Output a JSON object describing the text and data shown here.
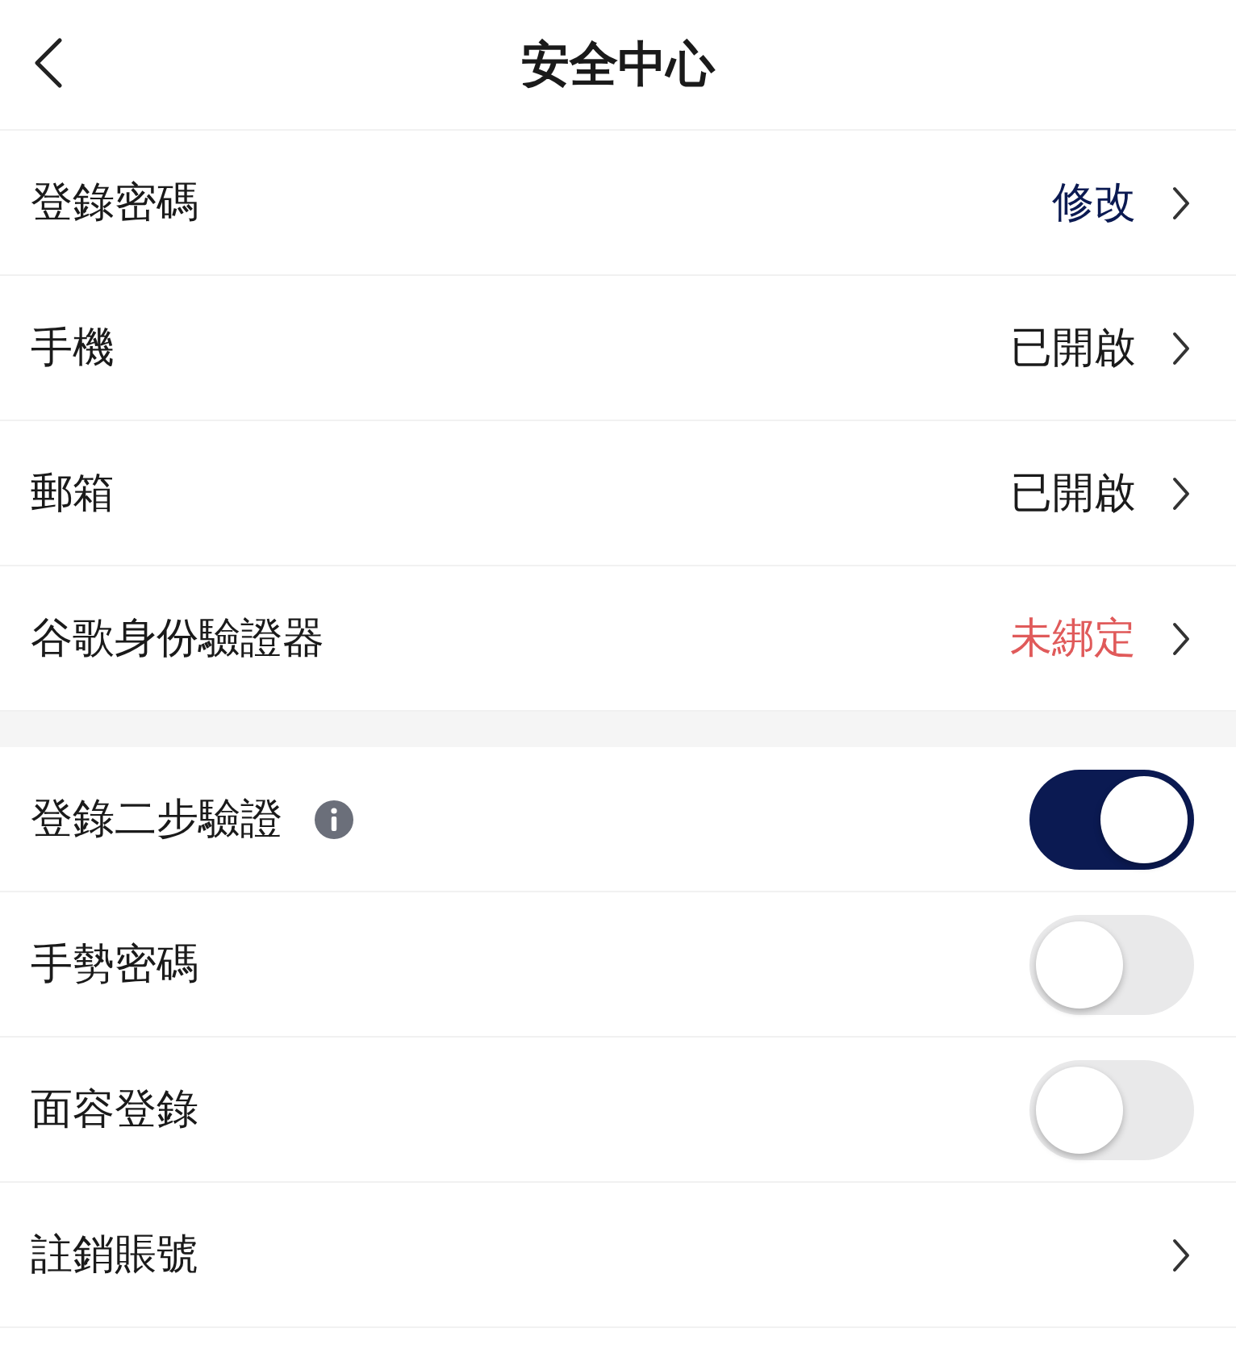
{
  "header": {
    "title": "安全中心"
  },
  "sections": [
    {
      "rows": [
        {
          "kind": "link",
          "label": "登錄密碼",
          "value": "修改",
          "color": "#0b1a52"
        },
        {
          "kind": "link",
          "label": "手機",
          "value": "已開啟",
          "color": "#1a1a1a"
        },
        {
          "kind": "link",
          "label": "郵箱",
          "value": "已開啟",
          "color": "#1a1a1a"
        },
        {
          "kind": "link",
          "label": "谷歌身份驗證器",
          "value": "未綁定",
          "color": "#e05a5a"
        }
      ]
    },
    {
      "rows": [
        {
          "kind": "toggle",
          "label": "登錄二步驗證",
          "info": true,
          "on": true
        },
        {
          "kind": "toggle",
          "label": "手勢密碼",
          "on": false
        },
        {
          "kind": "toggle",
          "label": "面容登錄",
          "on": false
        },
        {
          "kind": "link",
          "label": "註銷賬號"
        }
      ]
    }
  ]
}
